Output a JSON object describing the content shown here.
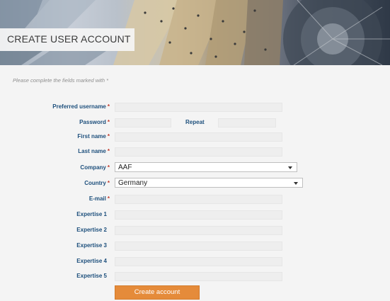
{
  "banner": {
    "title": "CREATE USER ACCOUNT"
  },
  "instructions": "Please complete the fields marked with *",
  "form": {
    "required_marker": "*",
    "preferred_username_label": "Preferred username",
    "password_label": "Password",
    "repeat_label": "Repeat",
    "first_name_label": "First name",
    "last_name_label": "Last name",
    "company_label": "Company",
    "company_value": "AAF",
    "country_label": "Country",
    "country_value": "Germany",
    "email_label": "E-mail",
    "expertise_1_label": "Expertise 1",
    "expertise_2_label": "Expertise 2",
    "expertise_3_label": "Expertise 3",
    "expertise_4_label": "Expertise 4",
    "expertise_5_label": "Expertise 5"
  },
  "actions": {
    "create_account_label": "Create account"
  },
  "colors": {
    "label_blue": "#1d4f7c",
    "required_red": "#c0392b",
    "button_orange": "#e58b3a"
  }
}
